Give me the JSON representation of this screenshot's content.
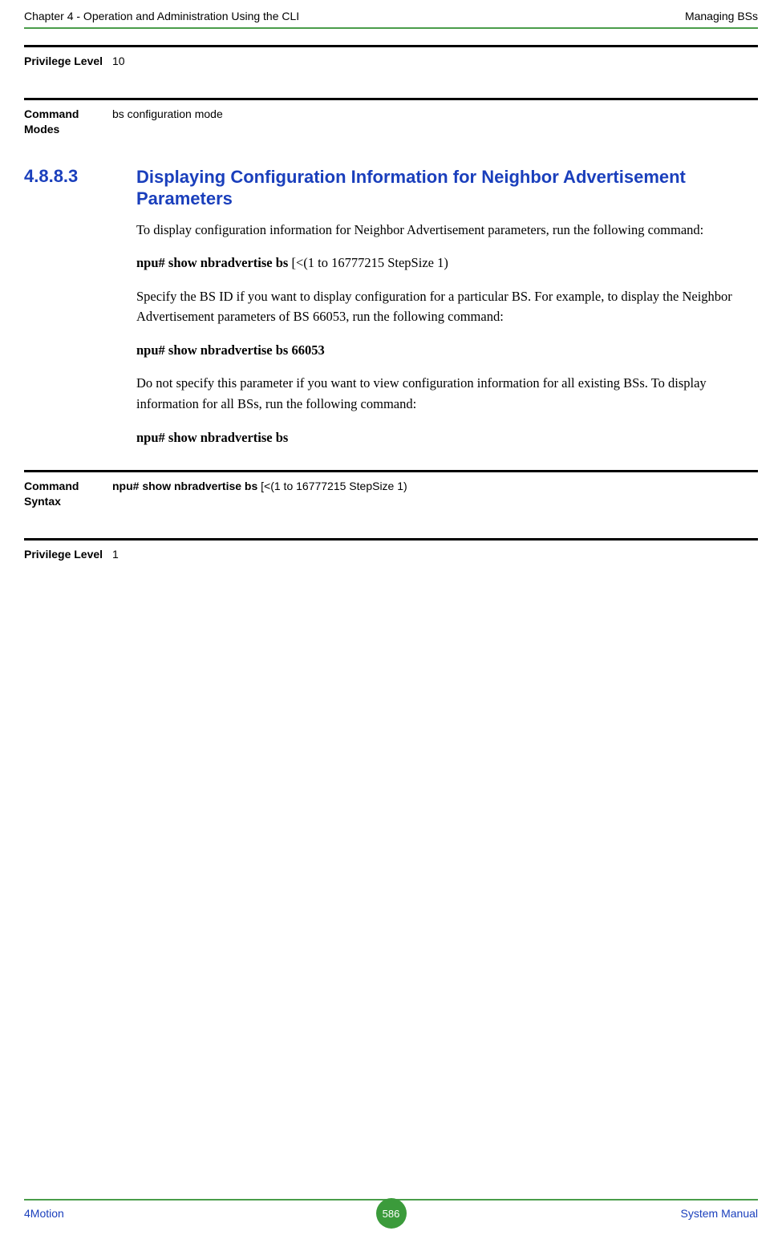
{
  "header": {
    "left": "Chapter 4 - Operation and Administration Using the CLI",
    "right": "Managing BSs"
  },
  "defs": {
    "priv10": {
      "label": "Privilege Level",
      "value": "10"
    },
    "cmdmodes": {
      "label": "Command Modes",
      "value": "bs configuration mode"
    },
    "cmdsyntax": {
      "label": "Command Syntax",
      "value_bold": "npu# show nbradvertise bs ",
      "value_rest": "[<(1 to 16777215 StepSize 1)"
    },
    "priv1": {
      "label": "Privilege Level",
      "value": "1"
    }
  },
  "section": {
    "number": "4.8.8.3",
    "title": "Displaying Configuration Information for Neighbor Advertisement Parameters"
  },
  "body": {
    "p1": "To display configuration information for Neighbor Advertisement parameters, run the following command:",
    "cmd1_bold": "npu# show nbradvertise bs ",
    "cmd1_rest": "[<(1 to 16777215 StepSize 1)",
    "p2": "Specify the BS ID if you want to display configuration for a particular BS. For example, to display the Neighbor Advertisement parameters of BS 66053, run the following command:",
    "cmd2": "npu# show nbradvertise bs 66053",
    "p3": "Do not specify this parameter if you want to view configuration information for all existing BSs. To display information for all BSs, run the following command:",
    "cmd3": "npu# show nbradvertise bs"
  },
  "footer": {
    "left": "4Motion",
    "page": "586",
    "right": "System Manual"
  }
}
